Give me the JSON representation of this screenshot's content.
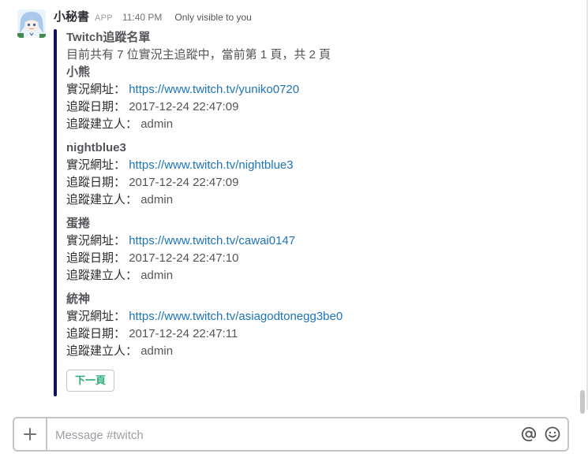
{
  "message": {
    "sender": "小秘書",
    "badge": "APP",
    "time": "11:40 PM",
    "visibility": "Only visible to you",
    "avatar_icon": "anime-girl-avatar-icon"
  },
  "attachment": {
    "accent_color": "#0d1459",
    "title": "Twitch追蹤名單",
    "summary": "目前共有 7 位實況主追蹤中，當前第 1 頁，共 2 頁",
    "url_label": "實況網址：",
    "date_label": "追蹤日期：",
    "creator_label": "追蹤建立人：",
    "entries": [
      {
        "name": "小熊",
        "url": "https://www.twitch.tv/yuniko0720",
        "date": "2017-12-24 22:47:09",
        "creator": "admin"
      },
      {
        "name": "nightblue3",
        "url": "https://www.twitch.tv/nightblue3",
        "date": "2017-12-24 22:47:09",
        "creator": "admin"
      },
      {
        "name": "蛋捲",
        "url": "https://www.twitch.tv/cawai0147",
        "date": "2017-12-24 22:47:10",
        "creator": "admin"
      },
      {
        "name": "統神",
        "url": "https://www.twitch.tv/asiagodtonegg3be0",
        "date": "2017-12-24 22:47:11",
        "creator": "admin"
      }
    ],
    "next_button": "下一頁",
    "next_button_color": "#2bac76"
  },
  "composer": {
    "placeholder": "Message #twitch",
    "value": "",
    "plus_icon": "plus-icon",
    "at_icon": "at-sign-icon",
    "emoji_icon": "smiley-icon"
  }
}
